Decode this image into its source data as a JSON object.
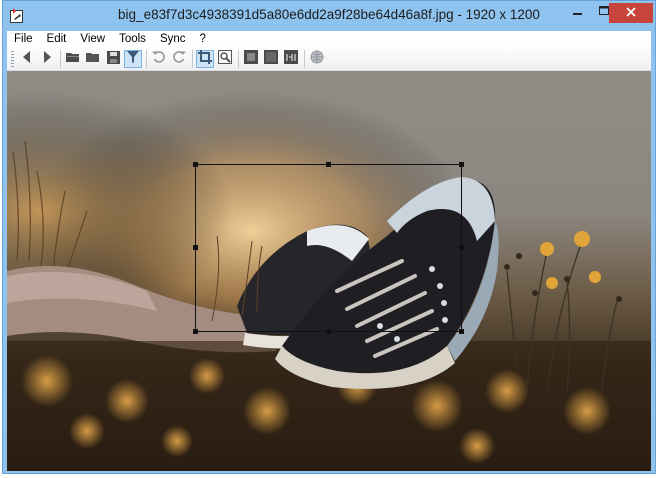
{
  "window": {
    "title": "big_e83f7d3c4938391d5a80e6dd2a9f28be64d46a8f.jpg - 1920 x 1200",
    "controls": {
      "minimize": "minimize-icon",
      "maximize": "maximize-icon",
      "close": "close-icon"
    }
  },
  "menu": {
    "items": [
      {
        "label": "File"
      },
      {
        "label": "Edit"
      },
      {
        "label": "View"
      },
      {
        "label": "Tools"
      },
      {
        "label": "Sync"
      },
      {
        "label": "?"
      }
    ]
  },
  "toolbar": {
    "buttons": [
      {
        "icon": "arrow-left-icon"
      },
      {
        "icon": "arrow-right-icon"
      },
      {
        "icon": "open-folder-icon"
      },
      {
        "icon": "folder-icon"
      },
      {
        "icon": "save-icon"
      },
      {
        "icon": "filter-icon",
        "active": true
      },
      {
        "icon": "rotate-left-icon"
      },
      {
        "icon": "rotate-right-icon"
      },
      {
        "icon": "crop-icon",
        "active": true
      },
      {
        "icon": "zoom-selection-icon"
      },
      {
        "icon": "fit-window-icon"
      },
      {
        "icon": "fullscreen-icon"
      },
      {
        "icon": "actual-size-icon"
      },
      {
        "icon": "globe-icon"
      }
    ]
  },
  "image": {
    "description_icon": "sneakers-photo",
    "selection": "crop-selection"
  }
}
